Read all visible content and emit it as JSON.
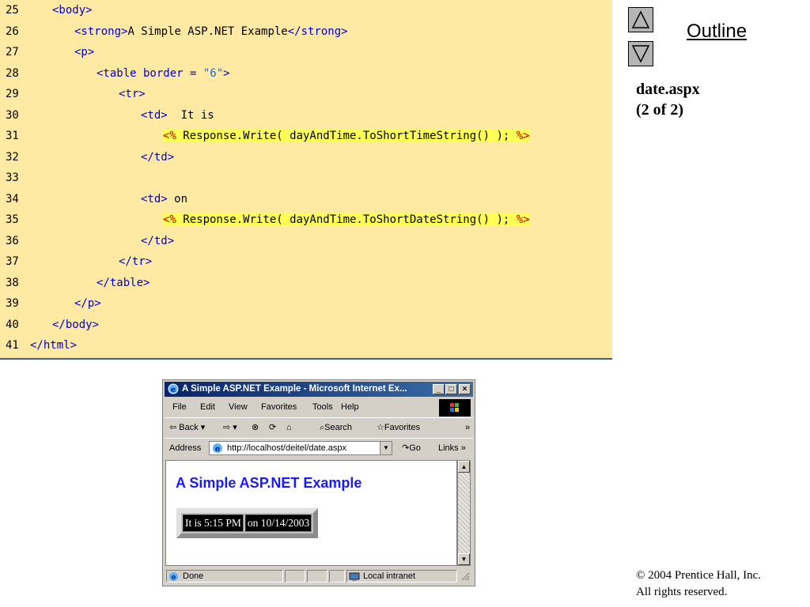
{
  "code_listing": {
    "lines": [
      {
        "num": "25",
        "indent": 1,
        "parts": [
          {
            "t": "<body>",
            "c": "tag"
          }
        ]
      },
      {
        "num": "26",
        "indent": 2,
        "parts": [
          {
            "t": "<strong>",
            "c": "tag"
          },
          {
            "t": "A Simple ASP.NET Example",
            "c": "txt"
          },
          {
            "t": "</strong>",
            "c": "tag"
          }
        ]
      },
      {
        "num": "27",
        "indent": 2,
        "parts": [
          {
            "t": "<p>",
            "c": "tag"
          }
        ]
      },
      {
        "num": "28",
        "indent": 3,
        "parts": [
          {
            "t": "<table border = ",
            "c": "tag"
          },
          {
            "t": "\"6\"",
            "c": "str"
          },
          {
            "t": ">",
            "c": "tag"
          }
        ]
      },
      {
        "num": "29",
        "indent": 4,
        "parts": [
          {
            "t": "<tr>",
            "c": "tag"
          }
        ]
      },
      {
        "num": "30",
        "indent": 5,
        "parts": [
          {
            "t": "<td>",
            "c": "tag"
          },
          {
            "t": "  It is",
            "c": "txt"
          }
        ]
      },
      {
        "num": "31",
        "indent": 6,
        "parts": [
          {
            "t": "<%",
            "c": "dlm"
          },
          {
            "t": " Response.Write( dayAndTime.ToShortTimeString() ); ",
            "c": "asp"
          },
          {
            "t": "%>",
            "c": "dlm"
          }
        ]
      },
      {
        "num": "32",
        "indent": 5,
        "parts": [
          {
            "t": "</td>",
            "c": "tag"
          }
        ]
      },
      {
        "num": "33",
        "indent": 0,
        "parts": []
      },
      {
        "num": "34",
        "indent": 5,
        "parts": [
          {
            "t": "<td>",
            "c": "tag"
          },
          {
            "t": " on",
            "c": "txt"
          }
        ]
      },
      {
        "num": "35",
        "indent": 6,
        "parts": [
          {
            "t": "<%",
            "c": "dlm"
          },
          {
            "t": " Response.Write( dayAndTime.ToShortDateString() ); ",
            "c": "asp"
          },
          {
            "t": "%>",
            "c": "dlm"
          }
        ]
      },
      {
        "num": "36",
        "indent": 5,
        "parts": [
          {
            "t": "</td>",
            "c": "tag"
          }
        ]
      },
      {
        "num": "37",
        "indent": 4,
        "parts": [
          {
            "t": "</tr>",
            "c": "tag"
          }
        ]
      },
      {
        "num": "38",
        "indent": 3,
        "parts": [
          {
            "t": "</table>",
            "c": "tag"
          }
        ]
      },
      {
        "num": "39",
        "indent": 2,
        "parts": [
          {
            "t": "</p>",
            "c": "tag"
          }
        ]
      },
      {
        "num": "40",
        "indent": 1,
        "parts": [
          {
            "t": "</body>",
            "c": "tag"
          }
        ]
      },
      {
        "num": "41",
        "indent": 0,
        "parts": [
          {
            "t": "</html>",
            "c": "tag"
          }
        ]
      }
    ]
  },
  "sidebar": {
    "outline_label": "Outline",
    "file_title_line1": "date.aspx",
    "file_title_line2": "(2 of 2)",
    "up_icon": "triangle-up-icon",
    "down_icon": "triangle-down-icon"
  },
  "copyright": {
    "line1": "© 2004 Prentice Hall, Inc.",
    "line2": "All rights reserved."
  },
  "browser": {
    "title": "A Simple ASP.NET Example - Microsoft Internet Ex...",
    "menu": [
      "File",
      "Edit",
      "View",
      "Favorites",
      "Tools",
      "Help"
    ],
    "toolbar": {
      "back": "Back",
      "search": "Search",
      "favorites": "Favorites"
    },
    "address_label": "Address",
    "url": "http://localhost/deitel/date.aspx",
    "go_label": "Go",
    "links_label": "Links",
    "page_heading": "A Simple ASP.NET Example",
    "table_cells": [
      "It is 5:15 PM",
      "on 10/14/2003"
    ],
    "status_left": "Done",
    "status_zone": "Local intranet"
  },
  "colors": {
    "code_background": "#ffe9a3",
    "tag_color": "#0000cc",
    "asp_highlight": "#ffff55",
    "heading_blue": "#1a1aff"
  }
}
